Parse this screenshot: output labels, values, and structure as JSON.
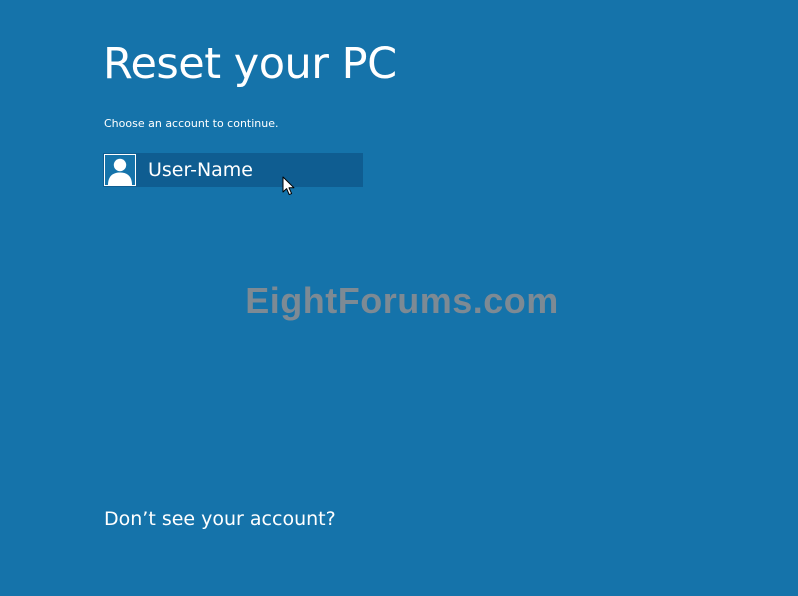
{
  "header": {
    "title": "Reset your PC",
    "subtitle": "Choose an account to continue."
  },
  "accounts": [
    {
      "name": "User-Name",
      "icon": "user-avatar-icon"
    }
  ],
  "watermark": "EightForums.com",
  "footer": {
    "link_label": "Don’t see your account?"
  },
  "colors": {
    "background": "#1573aa",
    "tile_selected": "#0f5d91",
    "text": "#ffffff",
    "watermark": "#7d8a94"
  }
}
